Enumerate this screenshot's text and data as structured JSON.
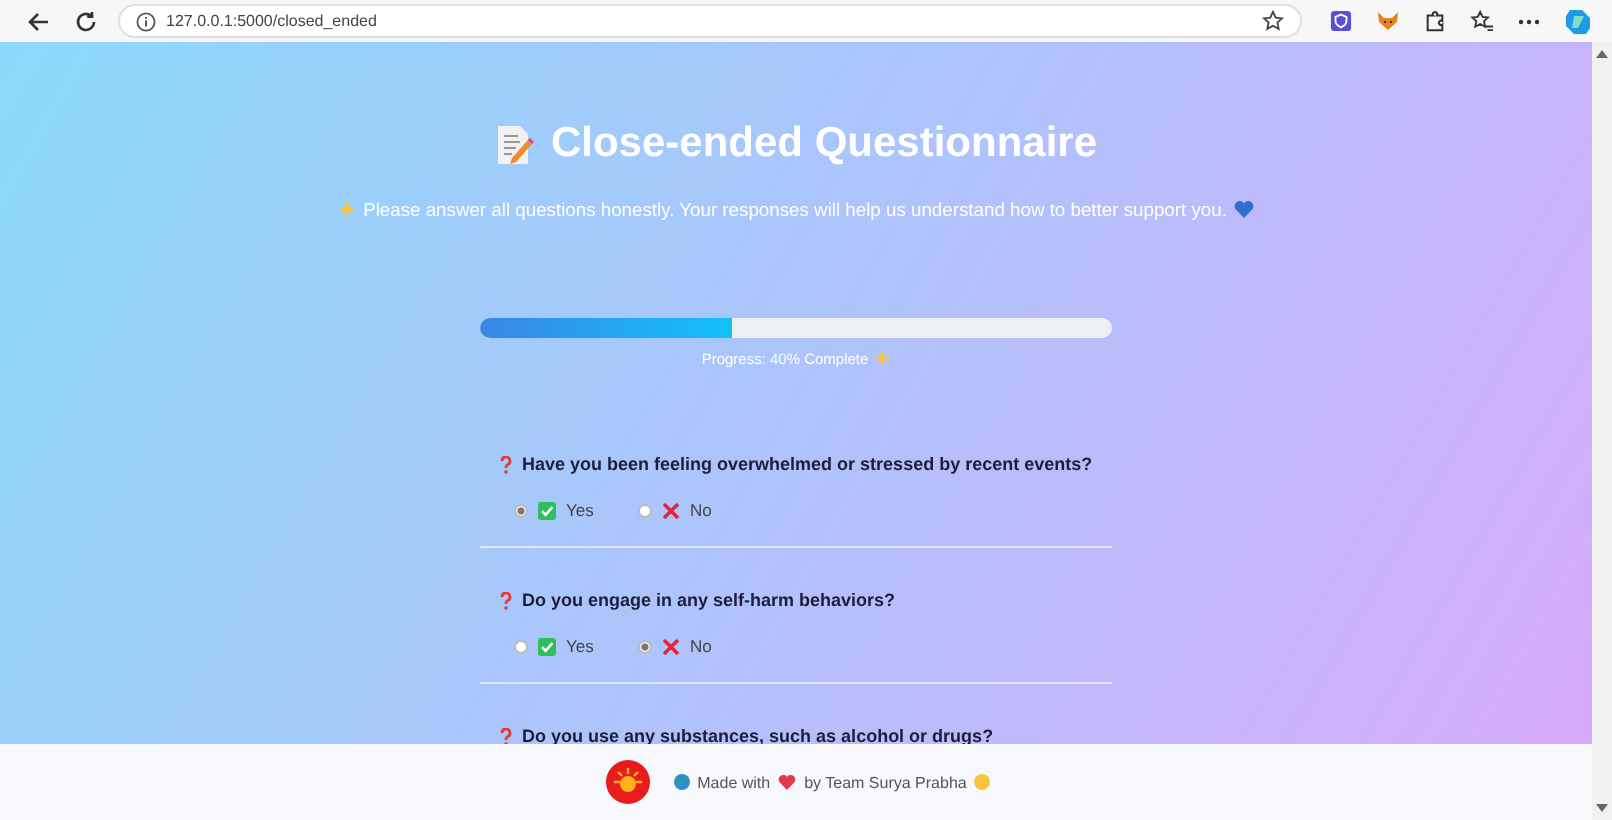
{
  "browser": {
    "url": "127.0.0.1:5000/closed_ended"
  },
  "title": "Close-ended Questionnaire",
  "subtitle": "Please answer all questions honestly. Your responses will help us understand how to better support you.",
  "progress": {
    "level": 0.4,
    "label": "Progress: 40% Complete"
  },
  "questions": [
    {
      "text": "Have you been feeling overwhelmed or stressed by recent events?",
      "options": [
        {
          "label": "Yes",
          "kind": "yes",
          "selected": true
        },
        {
          "label": "No",
          "kind": "no",
          "selected": false
        }
      ]
    },
    {
      "text": "Do you engage in any self-harm behaviors?",
      "options": [
        {
          "label": "Yes",
          "kind": "yes",
          "selected": false
        },
        {
          "label": "No",
          "kind": "no",
          "selected": true
        }
      ]
    },
    {
      "text": "Do you use any substances, such as alcohol or drugs?"
    }
  ],
  "footer": {
    "before_heart": "Made with",
    "after_heart": "by Team Surya Prabha"
  }
}
